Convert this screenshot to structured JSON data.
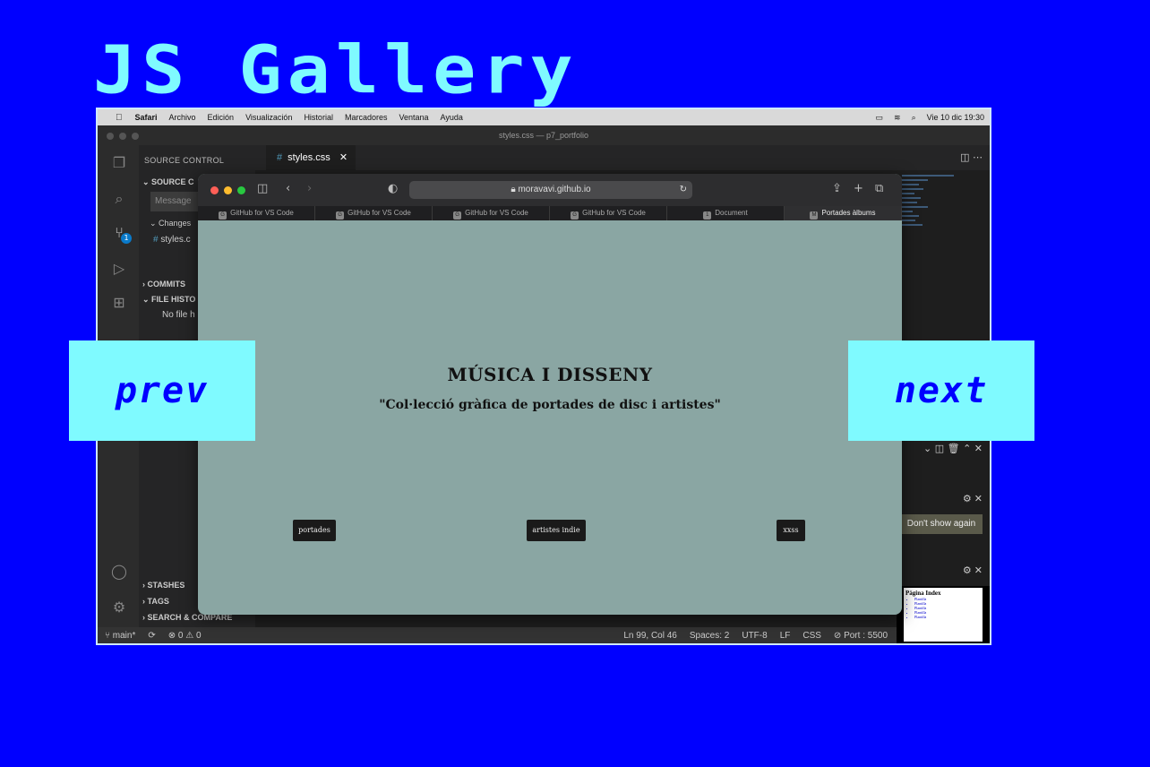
{
  "gallery": {
    "title": "JS Gallery",
    "prev_label": "prev",
    "next_label": "next"
  },
  "menubar": {
    "app": "Safari",
    "items": [
      "Archivo",
      "Edición",
      "Visualización",
      "Historial",
      "Marcadores",
      "Ventana",
      "Ayuda"
    ],
    "datetime": "Vie 10 dic  19:30"
  },
  "vscode": {
    "window_title": "styles.css — p7_portfolio",
    "sidebar": {
      "header": "SOURCE CONTROL",
      "section": "SOURCE C",
      "message_placeholder": "Message",
      "changes": "Changes",
      "file": "styles.c",
      "commits": "COMMITS",
      "file_history": "FILE HISTO",
      "no_file": "No file h",
      "stashes": "STASHES",
      "tags": "TAGS",
      "search_compare": "SEARCH & COMPARE"
    },
    "badge": "1",
    "tab": {
      "name": "styles.css"
    },
    "notification": {
      "dont_show_label": "Don't show again"
    },
    "statusbar": {
      "branch": "main*",
      "problems": "⊗ 0 ⚠ 0",
      "position": "Ln 99, Col 46",
      "spaces": "Spaces: 2",
      "encoding": "UTF-8",
      "eol": "LF",
      "language": "CSS",
      "port": "⊘ Port : 5500"
    },
    "thumbnail": {
      "title": "Pàgina Index",
      "items": [
        "Plantilla",
        "Plantilla",
        "Plantilla",
        "Plantilla",
        "Plantilla"
      ]
    }
  },
  "safari": {
    "url": "moravavi.github.io",
    "tabs": [
      {
        "fav": "G",
        "label": "GitHub for VS Code"
      },
      {
        "fav": "G",
        "label": "GitHub for VS Code"
      },
      {
        "fav": "G",
        "label": "GitHub for VS Code"
      },
      {
        "fav": "G",
        "label": "GitHub for VS Code"
      },
      {
        "fav": "1",
        "label": "Document"
      },
      {
        "fav": "M",
        "label": "Portades àlbums"
      }
    ],
    "page": {
      "heading": "MÚSICA I DISSENY",
      "subheading": "\"Col·lecció gràfica de portades de disc i artistes\"",
      "buttons": [
        "portades",
        "artistes indie",
        "xxss"
      ]
    }
  },
  "colors": {
    "background": "#0000ff",
    "accent": "#7ffaff",
    "page_bg": "#8aa6a3"
  }
}
